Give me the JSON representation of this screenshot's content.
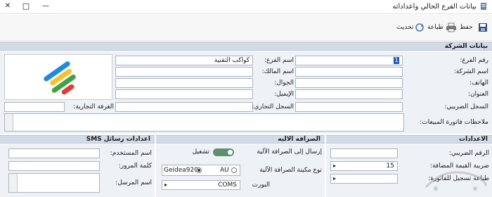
{
  "window": {
    "title": "بيانات الفرع الحالي واعداداته",
    "minimize": "—",
    "maximize": "□",
    "close": "✕"
  },
  "toolbar": {
    "save_label": "حفظ",
    "print_label": "طباعة",
    "refresh_label": "تحديث"
  },
  "company_section": {
    "title": "بيانات الشركة",
    "branch_no_label": "رقم الفرع:",
    "branch_no_value": "1",
    "branch_name_label": "اسم الفرع:",
    "branch_name_value": "كواكب التقنية",
    "company_name_label": "اسم الشركة:",
    "owner_name_label": "اسم المالك:",
    "phone_label": "الهاتف:",
    "mobile_label": "الجوال:",
    "address_label": "العنوان:",
    "email_label": "الإيميل:",
    "tax_record_label": "السجل الضريبي:",
    "commercial_record_label": "السجل التجاري:",
    "chamber_label": "الغرفة التجارية:",
    "invoice_notes_label": "ملاحظات فاتورة المبيعات:"
  },
  "settings_section": {
    "title": "الاعدادات",
    "tax_number_label": "الرقم الضريبي:",
    "vat_label": "ضريبة القيمة المضافة:",
    "vat_value": "15",
    "print_label": "طباعة تسجيل للفاتورة:"
  },
  "atm_section": {
    "title": "الصرافه الاليه",
    "send_label": "إرسال إلى الصرافة الآلية",
    "toggle_label": "تشغيل",
    "machine_type_label": "نوع مكينة الصرافة الآلية",
    "option_1": "Geidea920",
    "option_2": "AU",
    "port_label": "البورت",
    "port_value": "COMS"
  },
  "sms_section": {
    "title": "اعدادات رسائل SMS",
    "username_label": "اسم المستخدم:",
    "password_label": "كلمة المرور:",
    "sender_label": "اسم المرسل:"
  },
  "watermark": "حراج",
  "colors": {
    "section_header": "#d3dbe6",
    "panel_bg": "#eef1f6",
    "toggle_on": "#5f8f73",
    "logo_blue": "#1e88e5",
    "logo_yellow": "#fbc02d",
    "logo_green": "#43a047",
    "logo_red": "#e53935"
  }
}
